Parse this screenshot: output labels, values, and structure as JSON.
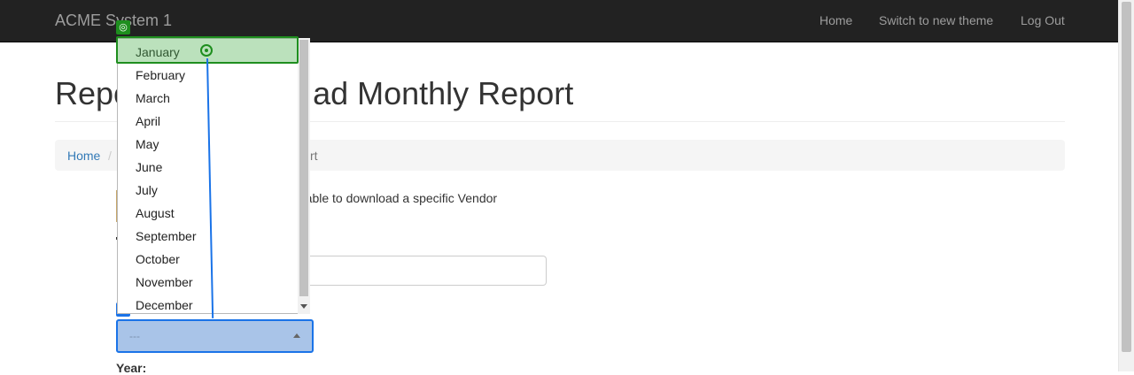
{
  "navbar": {
    "brand": "ACME System 1",
    "links": [
      "Home",
      "Switch to new theme",
      "Log Out"
    ]
  },
  "page": {
    "title": "Repo",
    "title_tail": "ad Monthly Report",
    "breadcrumb": {
      "home": "Home",
      "separator": "/",
      "current_tail": "rt"
    },
    "info_text": "e able to download a specific Vendor",
    "year_label": "Year:"
  },
  "month_select": {
    "value": "---",
    "options": [
      "January",
      "February",
      "March",
      "April",
      "May",
      "June",
      "July",
      "August",
      "September",
      "October",
      "November",
      "December"
    ],
    "highlighted": "January"
  },
  "colors": {
    "navbar_bg": "#222222",
    "link": "#337ab7",
    "highlight": "#1e8e1e",
    "anchor": "#1a73e8"
  }
}
